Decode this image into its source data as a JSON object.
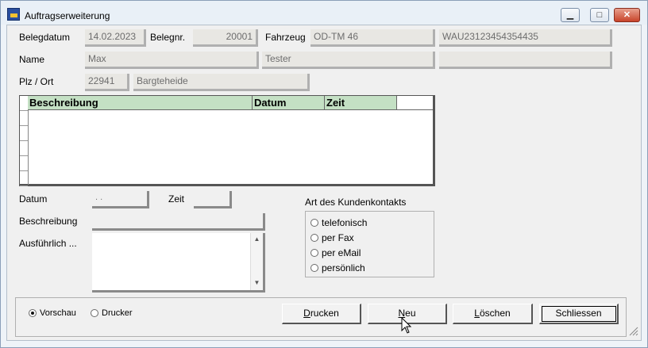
{
  "window": {
    "title": "Auftragserweiterung",
    "min_label": "▁",
    "max_label": "□",
    "close_label": "✕"
  },
  "header": {
    "belegdatum_label": "Belegdatum",
    "belegdatum_value": "14.02.2023",
    "belegnr_label": "Belegnr.",
    "belegnr_value": "20001",
    "fahrzeug_label": "Fahrzeug",
    "fahrzeug_value": "OD-TM 46",
    "vin_value": "WAU23123454354435",
    "name_label": "Name",
    "vorname_value": "Max",
    "nachname_value": "Tester",
    "extra_value": "",
    "plz_label": "Plz / Ort",
    "plz_value": "22941",
    "ort_value": "Bargteheide"
  },
  "table": {
    "columns": [
      "Beschreibung",
      "Datum",
      "Zeit"
    ],
    "rows": []
  },
  "form": {
    "datum_label": "Datum",
    "datum_value": " .  .",
    "zeit_label": "Zeit",
    "zeit_value": "",
    "beschreibung_label": "Beschreibung",
    "beschreibung_value": "",
    "ausfuehrlich_label": "Ausführlich ...",
    "ausfuehrlich_value": ""
  },
  "contact": {
    "title": "Art des Kundenkontakts",
    "options": [
      "telefonisch",
      "per Fax",
      "per eMail",
      "persönlich"
    ],
    "selected": null
  },
  "output": {
    "options": [
      "Vorschau",
      "Drucker"
    ],
    "selected": "Vorschau"
  },
  "buttons": {
    "drucken": {
      "mnemonic": "D",
      "rest": "rucken"
    },
    "neu": {
      "mnemonic": "N",
      "rest": "eu"
    },
    "loeschen": {
      "mnemonic": "L",
      "rest": "öschen"
    },
    "schliessen": "Schliessen"
  }
}
